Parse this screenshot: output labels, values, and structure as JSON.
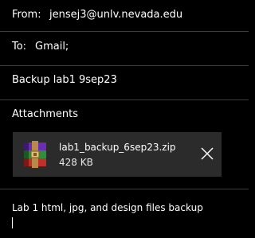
{
  "header": {
    "from_label": "From:",
    "from_value": "jensej3@unlv.nevada.edu",
    "to_label": "To:",
    "to_value": "Gmail;",
    "subject": "Backup lab1 9sep23"
  },
  "attachments": {
    "label": "Attachments",
    "items": [
      {
        "name": "lab1_backup_6sep23.zip",
        "size": "428 KB",
        "icon": "winrar-archive-icon"
      }
    ]
  },
  "body": {
    "text": "Lab 1 html, jpg, and design files backup"
  },
  "colors": {
    "background": "#000000",
    "card": "#2b2b2b",
    "divider": "#3c3c3c",
    "text": "#ffffff"
  }
}
